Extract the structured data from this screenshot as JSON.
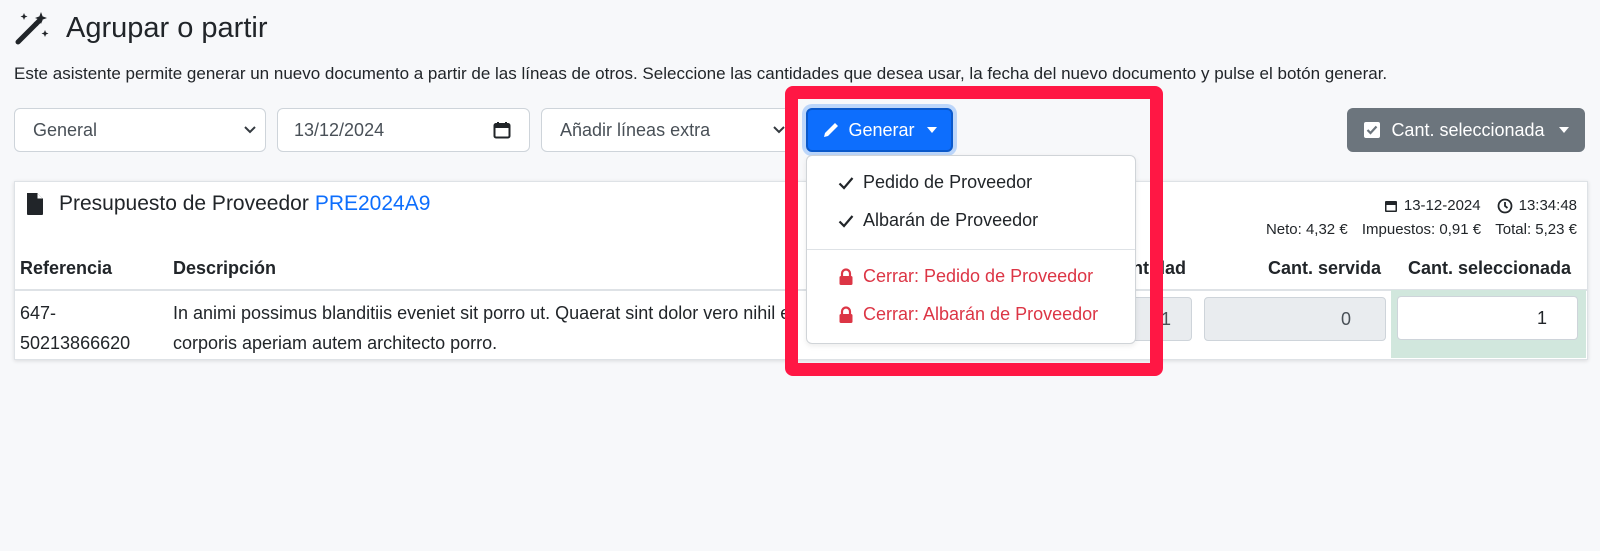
{
  "header": {
    "icon": "magic-wand-icon",
    "title": "Agrupar o partir",
    "description": "Este asistente permite generar un nuevo documento a partir de las líneas de otros. Seleccione las cantidades que desea usar, la fecha del nuevo documento y pulse el botón generar."
  },
  "toolbar": {
    "series_select": "General",
    "date_input": "13/12/2024",
    "extra_lines_select": "Añadir líneas extra",
    "generate_button": "Generar",
    "quantity_button": "Cant. seleccionada"
  },
  "generate_menu": {
    "items": [
      {
        "label": "Pedido de Proveedor",
        "icon": "check-icon",
        "style": "normal"
      },
      {
        "label": "Albarán de Proveedor",
        "icon": "check-icon",
        "style": "normal"
      },
      {
        "label": "Cerrar: Pedido de Proveedor",
        "icon": "lock-icon",
        "style": "danger"
      },
      {
        "label": "Cerrar: Albarán de Proveedor",
        "icon": "lock-icon",
        "style": "danger"
      }
    ]
  },
  "document": {
    "type": "Presupuesto de Proveedor",
    "code": "PRE2024A9",
    "date": "13-12-2024",
    "time": "13:34:48",
    "net": "Neto: 4,32 €",
    "taxes": "Impuestos: 0,91 €",
    "total": "Total: 5,23 €"
  },
  "table": {
    "columns": {
      "reference": "Referencia",
      "description": "Descripción",
      "quantity_partial": "ntidad",
      "served": "Cant. servida",
      "selected": "Cant. seleccionada"
    },
    "rows": [
      {
        "reference_line1": "647-",
        "reference_line2": "50213866620",
        "description_line1": "In animi possimus blanditiis eveniet sit porro ut. Quaerat sint dolor vero nihil e",
        "description_line2": "corporis aperiam autem architecto porro.",
        "quantity_partial": "1",
        "served": "0",
        "selected": "1"
      }
    ]
  },
  "colors": {
    "primary": "#0d6efd",
    "secondary": "#6c757d",
    "danger": "#dc3545",
    "highlight": "#ff1744",
    "selected_cell_bg": "#d1e7dd"
  }
}
